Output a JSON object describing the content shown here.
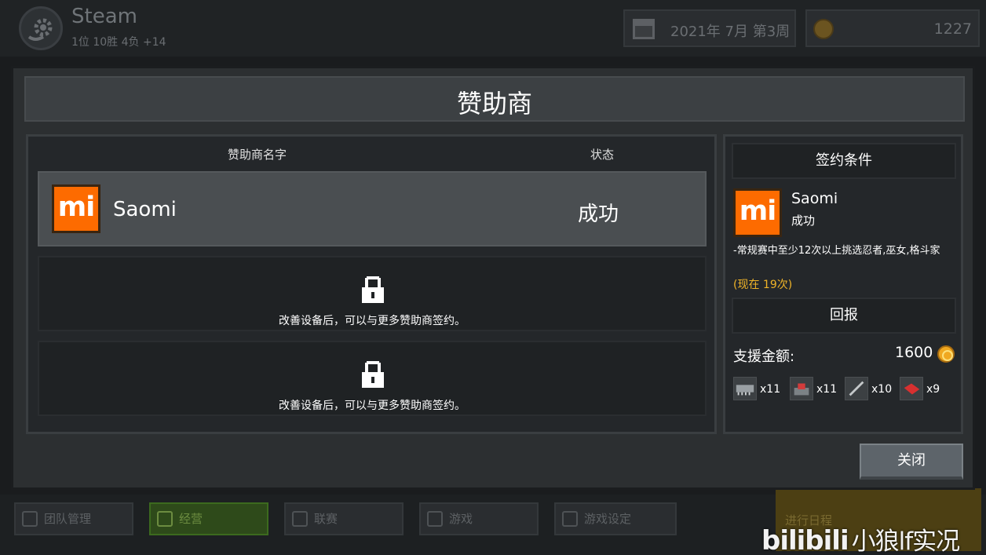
{
  "topbar": {
    "team_name": "Steam",
    "team_record": "1位 10胜 4负 +14",
    "date": "2021年 7月 第3周",
    "coins": "1227"
  },
  "nav": {
    "items": [
      {
        "label": "团队管理",
        "icon": "shield-icon"
      },
      {
        "label": "经营",
        "icon": "document-icon"
      },
      {
        "label": "联赛",
        "icon": "trophy-icon"
      },
      {
        "label": "游戏",
        "icon": "gamepad-icon"
      },
      {
        "label": "游戏设定",
        "icon": "gear-icon"
      }
    ],
    "active": "经营",
    "side_card_text": "进行日程"
  },
  "watermark": {
    "brand": "bilibili",
    "author": "小狼lf实况"
  },
  "modal": {
    "title": "赞助商",
    "columns": {
      "name": "赞助商名字",
      "status": "状态"
    },
    "sponsors": [
      {
        "name": "Saomi",
        "status": "成功",
        "logo_text": "mi",
        "logo_color": "#fd6b00"
      }
    ],
    "locked_rows": [
      {
        "text": "改善设备后，可以与更多赞助商签约。"
      },
      {
        "text": "改善设备后，可以与更多赞助商签约。"
      }
    ],
    "detail": {
      "conditions_title": "签约条件",
      "name": "Saomi",
      "status": "成功",
      "condition": "-常规赛中至少12次以上挑选忍者,巫女,格斗家",
      "progress": "(现在 19次)",
      "reward_title": "回报",
      "support_label": "支援金额:",
      "support_amount": "1600",
      "rewards": [
        {
          "icon": "circuit-board-icon",
          "qty": "x11"
        },
        {
          "icon": "joystick-icon",
          "qty": "x11"
        },
        {
          "icon": "pen-icon",
          "qty": "x10"
        },
        {
          "icon": "red-book-icon",
          "qty": "x9"
        }
      ]
    },
    "close_label": "关闭"
  },
  "colors": {
    "accent_orange": "#fd6b00",
    "gold_text": "#f0b428",
    "active_nav": "#2e4a1a"
  }
}
